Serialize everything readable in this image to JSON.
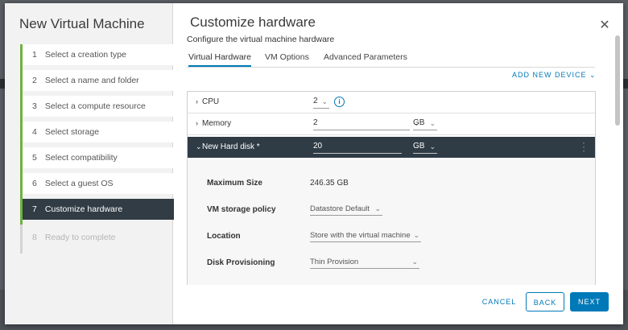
{
  "wizard": {
    "title": "New Virtual Machine",
    "steps": [
      {
        "num": "1",
        "label": "Select a creation type"
      },
      {
        "num": "2",
        "label": "Select a name and folder"
      },
      {
        "num": "3",
        "label": "Select a compute resource"
      },
      {
        "num": "4",
        "label": "Select storage"
      },
      {
        "num": "5",
        "label": "Select compatibility"
      },
      {
        "num": "6",
        "label": "Select a guest OS"
      },
      {
        "num": "7",
        "label": "Customize hardware"
      },
      {
        "num": "8",
        "label": "Ready to complete"
      }
    ]
  },
  "panel": {
    "title": "Customize hardware",
    "subtitle": "Configure the virtual machine hardware",
    "tabs": [
      "Virtual Hardware",
      "VM Options",
      "Advanced Parameters"
    ],
    "add_device": "ADD NEW DEVICE"
  },
  "hardware": {
    "cpu": {
      "label": "CPU",
      "value": "2"
    },
    "memory": {
      "label": "Memory",
      "value": "2",
      "unit": "GB"
    },
    "disk": {
      "label": "New Hard disk *",
      "value": "20",
      "unit": "GB"
    }
  },
  "disk_details": {
    "max_size": {
      "label": "Maximum Size",
      "value": "246.35 GB"
    },
    "storage_policy": {
      "label": "VM storage policy",
      "value": "Datastore Default"
    },
    "location": {
      "label": "Location",
      "value": "Store with the virtual machine"
    },
    "provisioning": {
      "label": "Disk Provisioning",
      "value": "Thin Provision"
    }
  },
  "footer": {
    "cancel": "CANCEL",
    "back": "BACK",
    "next": "NEXT"
  },
  "icons": {
    "close": "close-icon",
    "info": "info-icon",
    "chevron": "chevron-icon",
    "kebab": "more-vertical-icon"
  },
  "colors": {
    "accent": "#0079b8",
    "step_progress": "#6db33f",
    "active_step": "#313c44"
  }
}
